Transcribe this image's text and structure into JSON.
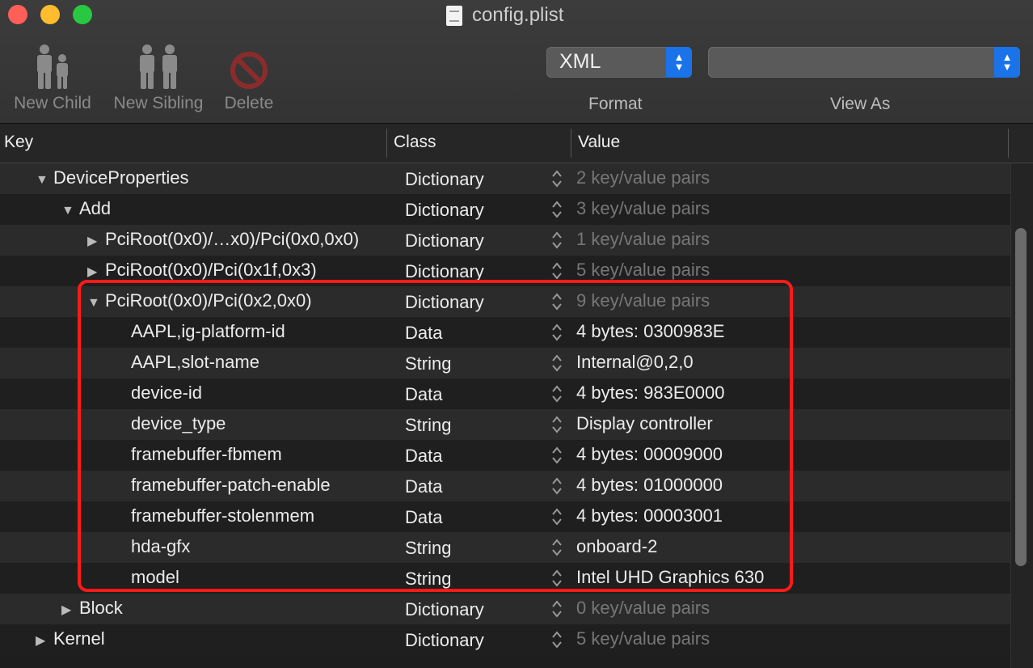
{
  "window": {
    "title": "config.plist"
  },
  "toolbar": {
    "new_child": "New Child",
    "new_sibling": "New Sibling",
    "delete": "Delete",
    "format_value": "XML",
    "format_label": "Format",
    "viewas_value": "",
    "viewas_label": "View As"
  },
  "columns": {
    "key": "Key",
    "class": "Class",
    "value": "Value"
  },
  "rows": [
    {
      "key": "DeviceProperties",
      "class": "Dictionary",
      "value": "2 key/value pairs"
    },
    {
      "key": "Add",
      "class": "Dictionary",
      "value": "3 key/value pairs"
    },
    {
      "key": "PciRoot(0x0)/…x0)/Pci(0x0,0x0)",
      "class": "Dictionary",
      "value": "1 key/value pairs"
    },
    {
      "key": "PciRoot(0x0)/Pci(0x1f,0x3)",
      "class": "Dictionary",
      "value": "5 key/value pairs"
    },
    {
      "key": "PciRoot(0x0)/Pci(0x2,0x0)",
      "class": "Dictionary",
      "value": "9 key/value pairs"
    },
    {
      "key": "AAPL,ig-platform-id",
      "class": "Data",
      "value": "4 bytes: 0300983E"
    },
    {
      "key": "AAPL,slot-name",
      "class": "String",
      "value": "Internal@0,2,0"
    },
    {
      "key": "device-id",
      "class": "Data",
      "value": "4 bytes: 983E0000"
    },
    {
      "key": "device_type",
      "class": "String",
      "value": "Display controller"
    },
    {
      "key": "framebuffer-fbmem",
      "class": "Data",
      "value": "4 bytes: 00009000"
    },
    {
      "key": "framebuffer-patch-enable",
      "class": "Data",
      "value": "4 bytes: 01000000"
    },
    {
      "key": "framebuffer-stolenmem",
      "class": "Data",
      "value": "4 bytes: 00003001"
    },
    {
      "key": "hda-gfx",
      "class": "String",
      "value": "onboard-2"
    },
    {
      "key": "model",
      "class": "String",
      "value": "Intel UHD Graphics 630"
    },
    {
      "key": "Block",
      "class": "Dictionary",
      "value": "0 key/value pairs"
    },
    {
      "key": "Kernel",
      "class": "Dictionary",
      "value": "5 key/value pairs"
    }
  ],
  "colors": {
    "highlight": "#ff1a1a",
    "accent": "#1a73e8"
  }
}
